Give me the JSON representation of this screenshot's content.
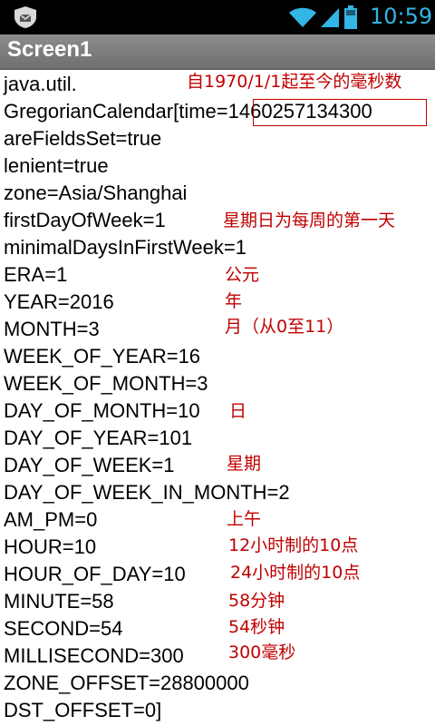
{
  "status_bar": {
    "time": "10:59"
  },
  "title_bar": {
    "title": "Screen1"
  },
  "lines": [
    "java.util.",
    "GregorianCalendar[time=1460257134300",
    "areFieldsSet=true",
    "lenient=true",
    "zone=Asia/Shanghai",
    "firstDayOfWeek=1",
    "minimalDaysInFirstWeek=1",
    "ERA=1",
    "YEAR=2016",
    "MONTH=3",
    "WEEK_OF_YEAR=16",
    "WEEK_OF_MONTH=3",
    "DAY_OF_MONTH=10",
    "DAY_OF_YEAR=101",
    "DAY_OF_WEEK=1",
    "DAY_OF_WEEK_IN_MONTH=2",
    "AM_PM=0",
    "HOUR=10",
    "HOUR_OF_DAY=10",
    "MINUTE=58",
    "SECOND=54",
    "MILLISECOND=300",
    "ZONE_OFFSET=28800000",
    "DST_OFFSET=0]"
  ],
  "annotations": [
    "自1970/1/1起至今的毫秒数",
    "星期日为每周的第一天",
    "公元",
    "年",
    "月（从0至11）",
    "日",
    "星期",
    "上午",
    "12小时制的10点",
    "24小时制的10点",
    "58分钟",
    "54秒钟",
    "300毫秒"
  ]
}
